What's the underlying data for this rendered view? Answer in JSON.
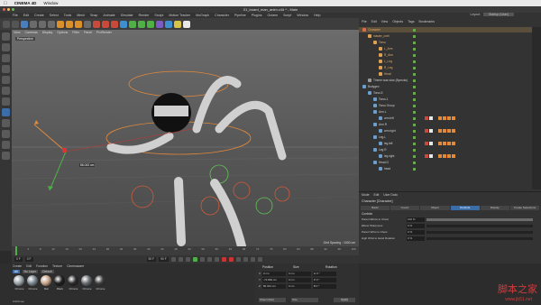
{
  "macbar": {
    "app": "CINEMA 4D",
    "menu": "Window"
  },
  "window": {
    "title": "01_board_man_anim.c4d * - Main"
  },
  "c4d_menu": [
    "File",
    "Edit",
    "Create",
    "Select",
    "Tools",
    "Mesh",
    "Snap",
    "Animate",
    "Simulate",
    "Render",
    "Sculpt",
    "Motion Tracker",
    "MoGraph",
    "Character",
    "Pipeline",
    "Plugins",
    "Octane",
    "Script",
    "Window",
    "Help"
  ],
  "layout": {
    "label": "Layout:",
    "value": "Startup (User)"
  },
  "viewport": {
    "menu": [
      "View",
      "Cameras",
      "Display",
      "Options",
      "Filter",
      "Panel",
      "ProRender"
    ],
    "mode": "Perspective",
    "grid_spacing": "Grid Spacing : 1000 cm",
    "axis_value": "86.043 cm"
  },
  "timeline": {
    "ticks": [
      "0",
      "4",
      "8",
      "12",
      "16",
      "20",
      "24",
      "28",
      "32",
      "36",
      "40",
      "44",
      "48",
      "52",
      "56",
      "60",
      "64",
      "68",
      "72",
      "76",
      "80",
      "84",
      "88",
      "92",
      "96",
      "100"
    ],
    "start": "0 F",
    "current": "0 F",
    "end": "90 F",
    "end2": "90 F"
  },
  "materials": {
    "menu": [
      "Create",
      "Edit",
      "Function",
      "Texture",
      "Cinemaware"
    ],
    "filters": [
      "All",
      "No Layer",
      "Default"
    ],
    "items": [
      {
        "label": "Chrome",
        "color": "#9aa3a8"
      },
      {
        "label": "Chrome",
        "color": "#7b8890"
      },
      {
        "label": "Skin",
        "color": "#c9a58a"
      },
      {
        "label": "Black",
        "color": "#1e1e1e"
      },
      {
        "label": "Chrome",
        "color": "#2b2b2b"
      },
      {
        "label": "Chrome",
        "color": "#6a6e72"
      },
      {
        "label": "Chrome",
        "color": "#3e3e3e"
      }
    ],
    "status": "0.020 sec"
  },
  "coordinates": {
    "headers": [
      "Position",
      "Size",
      "Rotation"
    ],
    "rows": [
      {
        "axis": "X",
        "pos": "0 cm",
        "size": "0 cm",
        "rot": "H 0 °"
      },
      {
        "axis": "Y",
        "pos": "-72.862 cm",
        "size": "0 cm",
        "rot": "P 0 °"
      },
      {
        "axis": "Z",
        "pos": "86.043 cm",
        "size": "0 cm",
        "rot": "B 0 °"
      }
    ],
    "object_mode": "Object (Rel)",
    "size_mode": "Size",
    "apply": "Apply"
  },
  "object_manager": {
    "menu": [
      "File",
      "Edit",
      "View",
      "Objects",
      "Tags",
      "Bookmarks"
    ],
    "rows": [
      {
        "name": "Character",
        "indent": 0,
        "color": "#e06a4a",
        "sel": true
      },
      {
        "name": "master_cntrl",
        "indent": 6,
        "color": "#e0a050"
      },
      {
        "name": "Torso",
        "indent": 12,
        "color": "#e0a050"
      },
      {
        "name": "L_Arm",
        "indent": 18,
        "color": "#e0a050"
      },
      {
        "name": "R_Arm",
        "indent": 18,
        "color": "#e0a050"
      },
      {
        "name": "L_Leg",
        "indent": 18,
        "color": "#e0a050"
      },
      {
        "name": "R_Leg",
        "indent": 18,
        "color": "#e0a050"
      },
      {
        "name": "Head",
        "indent": 18,
        "color": "#e0a050"
      },
      {
        "name": "Theme was slow (Bymoko)",
        "indent": 6,
        "color": "#9a9a9a"
      },
      {
        "name": "Bodygeo",
        "indent": 0,
        "color": "#6aa0d0"
      },
      {
        "name": "Torso.5",
        "indent": 6,
        "color": "#6aa0d0"
      },
      {
        "name": "Torso.1",
        "indent": 12,
        "color": "#6aa0d0"
      },
      {
        "name": "Torso Group",
        "indent": 12,
        "color": "#6aa0d0"
      },
      {
        "name": "Arm.L",
        "indent": 12,
        "color": "#6aa0d0"
      },
      {
        "name": "arm.left",
        "indent": 18,
        "color": "#6aa0d0",
        "tags": true
      },
      {
        "name": "Arm.R",
        "indent": 12,
        "color": "#6aa0d0"
      },
      {
        "name": "arm.right",
        "indent": 18,
        "color": "#6aa0d0",
        "tags": true
      },
      {
        "name": "Leg.L",
        "indent": 12,
        "color": "#6aa0d0"
      },
      {
        "name": "leg.left",
        "indent": 18,
        "color": "#6aa0d0",
        "tags": true
      },
      {
        "name": "Leg.R",
        "indent": 12,
        "color": "#6aa0d0"
      },
      {
        "name": "leg.right",
        "indent": 18,
        "color": "#6aa0d0",
        "tags": true
      },
      {
        "name": "Head.G",
        "indent": 12,
        "color": "#6aa0d0"
      },
      {
        "name": "head",
        "indent": 18,
        "color": "#6aa0d0"
      }
    ]
  },
  "attribute_manager": {
    "menu": [
      "Mode",
      "Edit",
      "User Data"
    ],
    "title": "Character [Character]",
    "tabs": [
      "Basic",
      "Coord.",
      "Object",
      "Controls",
      "Display",
      "Create Selections"
    ],
    "active_tab": "Controls",
    "section": "Controls",
    "rows": [
      {
        "label": "Parent Elbow to Chest",
        "value": "100 %",
        "fill": 1.0
      },
      {
        "label": "Elbow Sharpness",
        "value": "0 %",
        "fill": 0.0
      },
      {
        "label": "Parent Wrist to Chest",
        "value": "0 %",
        "fill": 0.0
      },
      {
        "label": "High Wrist to Hand Rotation",
        "value": "0 %",
        "fill": 0.0
      }
    ]
  },
  "watermark": {
    "text": "脚本之家",
    "url": "www.jb51.net"
  }
}
